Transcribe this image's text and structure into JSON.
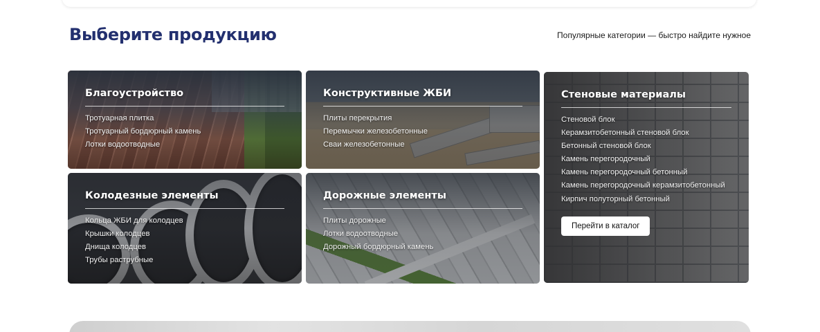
{
  "section": {
    "title": "Выберите продукцию",
    "subtitle": "Популярные категории — быстро найдите нужное"
  },
  "categories": [
    {
      "title": "Благоустройство",
      "items": [
        "Тротуарная плитка",
        "Тротуарный бордюрный камень",
        "Лотки водоотводные"
      ]
    },
    {
      "title": "Конструктивные ЖБИ",
      "items": [
        "Плиты перекрытия",
        "Перемычки железобетонные",
        "Сваи железобетонные"
      ]
    },
    {
      "title": "Колодезные элементы",
      "items": [
        "Кольца ЖБИ для колодцев",
        "Крышки колодцев",
        "Днища колодцев",
        "Трубы раструбные"
      ]
    },
    {
      "title": "Дорожные элементы",
      "items": [
        "Плиты дорожные",
        "Лотки водоотводные",
        "Дорожный бордюрный камень"
      ]
    },
    {
      "title": "Стеновые материалы",
      "items": [
        "Стеновой блок",
        "Керамзитобетонный стеновой блок",
        "Бетонный стеновой блок",
        "Камень перегородочный",
        "Камень перегородочный бетонный",
        "Камень перегородочный керамзитобетонный",
        "Кирпич полуторный бетонный"
      ],
      "button_label": "Перейти в каталог"
    }
  ],
  "colors": {
    "title": "#23306f",
    "card_text": "#ffffff",
    "button_bg": "#ffffff"
  }
}
